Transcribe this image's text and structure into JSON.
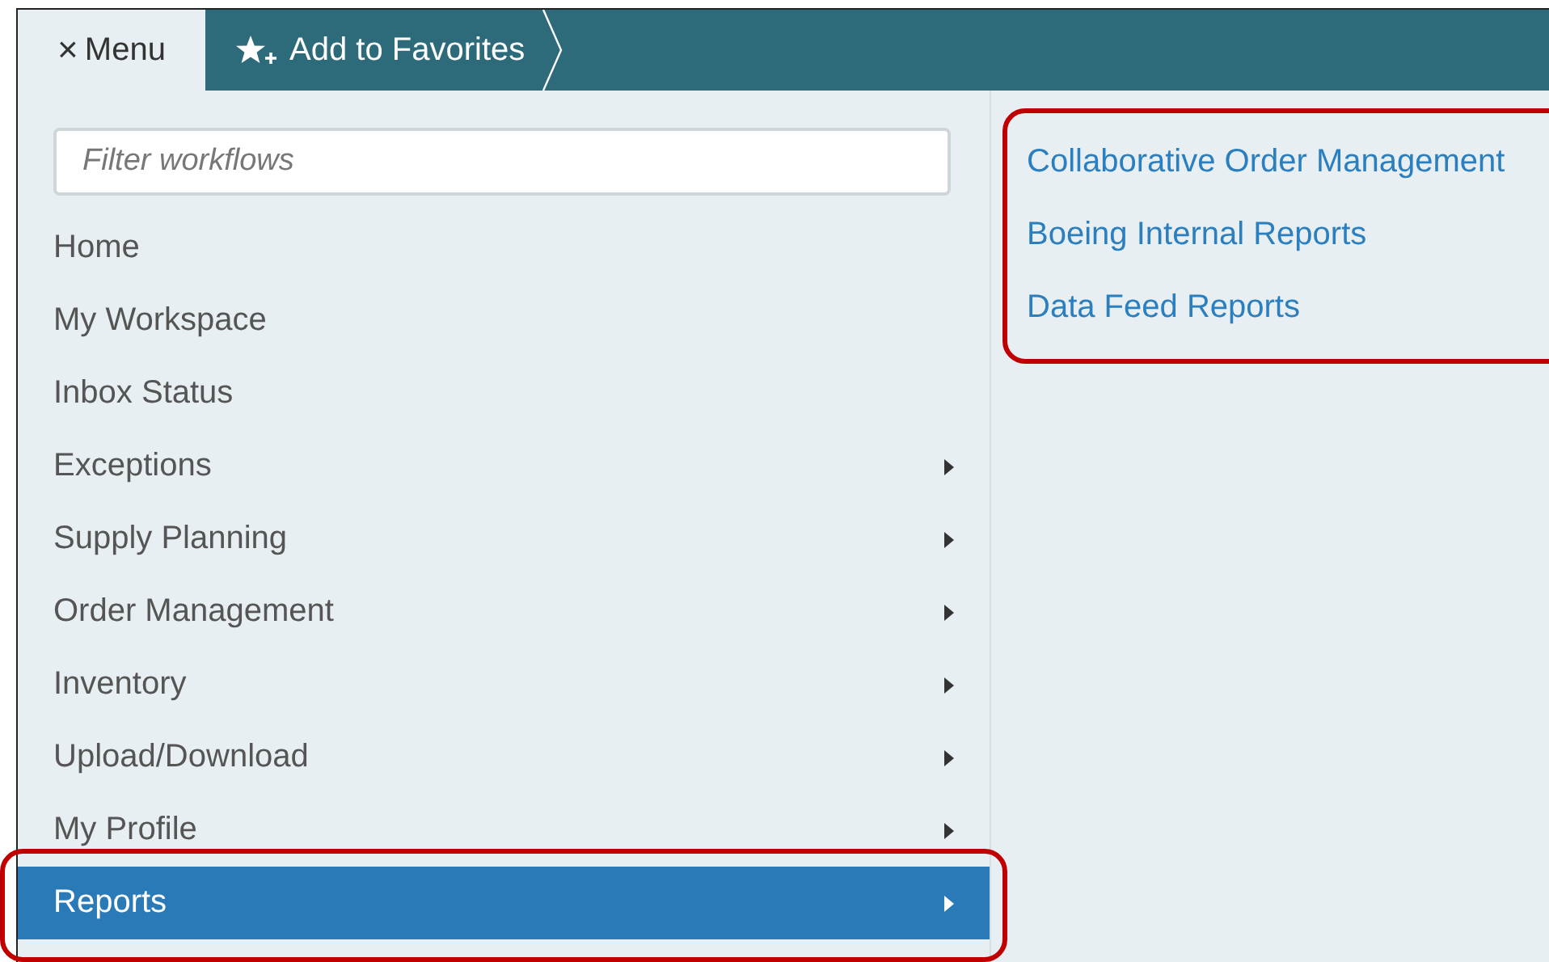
{
  "top_bar": {
    "close_tab": {
      "icon": "×",
      "label": "Menu"
    },
    "favorites_button": {
      "label": "Add to Favorites"
    }
  },
  "filter": {
    "placeholder": "Filter workflows"
  },
  "menu_items": [
    {
      "label": "Home",
      "has_submenu": false,
      "selected": false
    },
    {
      "label": "My Workspace",
      "has_submenu": false,
      "selected": false
    },
    {
      "label": "Inbox Status",
      "has_submenu": false,
      "selected": false
    },
    {
      "label": "Exceptions",
      "has_submenu": true,
      "selected": false
    },
    {
      "label": "Supply Planning",
      "has_submenu": true,
      "selected": false
    },
    {
      "label": "Order Management",
      "has_submenu": true,
      "selected": false
    },
    {
      "label": "Inventory",
      "has_submenu": true,
      "selected": false
    },
    {
      "label": "Upload/Download",
      "has_submenu": true,
      "selected": false
    },
    {
      "label": "My Profile",
      "has_submenu": true,
      "selected": false
    },
    {
      "label": "Reports",
      "has_submenu": true,
      "selected": true
    }
  ],
  "submenu_links": [
    "Collaborative Order Management",
    "Boeing Internal Reports",
    "Data Feed Reports"
  ]
}
